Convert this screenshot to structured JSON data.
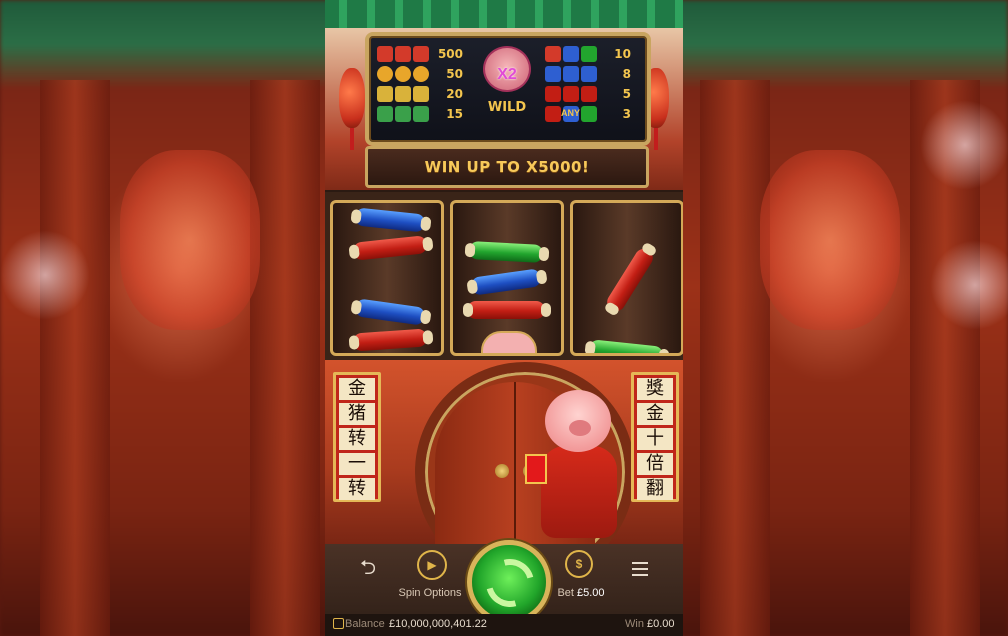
{
  "paytable": {
    "left_values": [
      "500",
      "50",
      "20",
      "15"
    ],
    "right_values": [
      "10",
      "8",
      "5",
      "3"
    ],
    "wild_multiplier": "X2",
    "wild_label": "WILD",
    "any_label": "ANY"
  },
  "banner_text": "WIN UP TO X5000!",
  "left_scroll": [
    "金",
    "猪",
    "转",
    "一",
    "转"
  ],
  "right_scroll": [
    "獎",
    "金",
    "十",
    "倍",
    "翻"
  ],
  "controls": {
    "spin_options_label": "Spin Options",
    "bet_label": "Bet",
    "bet_value": "£5.00"
  },
  "status": {
    "balance_label": "Balance",
    "balance_value": "£10,000,000,401.22",
    "win_label": "Win",
    "win_value": "£0.00"
  },
  "colors": {
    "accent_gold": "#f3c54e",
    "spin_green": "#21a52a",
    "frame_gold": "#d4a958"
  }
}
